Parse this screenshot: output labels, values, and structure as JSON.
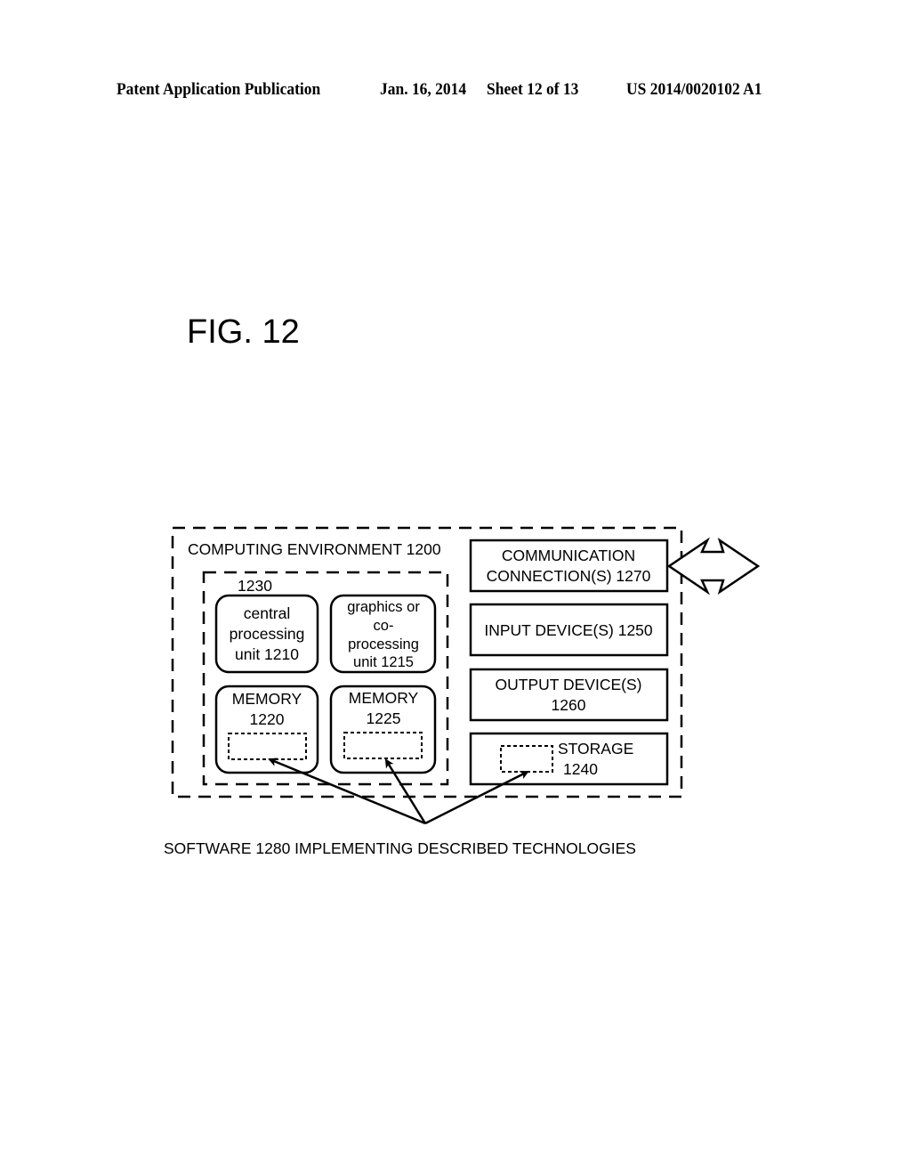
{
  "header": {
    "publication": "Patent Application Publication",
    "date": "Jan. 16, 2014",
    "sheet": "Sheet 12 of 13",
    "number": "US 2014/0020102 A1"
  },
  "figure": {
    "title": "FIG. 12"
  },
  "diagram": {
    "computing_environment": {
      "label": "COMPUTING ENVIRONMENT 1200"
    },
    "processing_group": {
      "label": "1230"
    },
    "cpu": {
      "lines": [
        "central",
        "processing",
        "unit 1210"
      ]
    },
    "gpu": {
      "lines": [
        "graphics or",
        "co-",
        "processing",
        "unit 1215"
      ]
    },
    "memory_1220": {
      "lines": [
        "MEMORY",
        "1220"
      ]
    },
    "memory_1225": {
      "lines": [
        "MEMORY",
        "1225"
      ]
    },
    "communication": {
      "lines": [
        "COMMUNICATION",
        "CONNECTION(S) 1270"
      ]
    },
    "input": {
      "lines": [
        "INPUT DEVICE(S) 1250"
      ]
    },
    "output": {
      "lines": [
        "OUTPUT DEVICE(S)",
        "1260"
      ]
    },
    "storage": {
      "lines": [
        "STORAGE",
        "1240"
      ]
    },
    "software": {
      "label": "SOFTWARE 1280 IMPLEMENTING DESCRIBED TECHNOLOGIES"
    }
  }
}
